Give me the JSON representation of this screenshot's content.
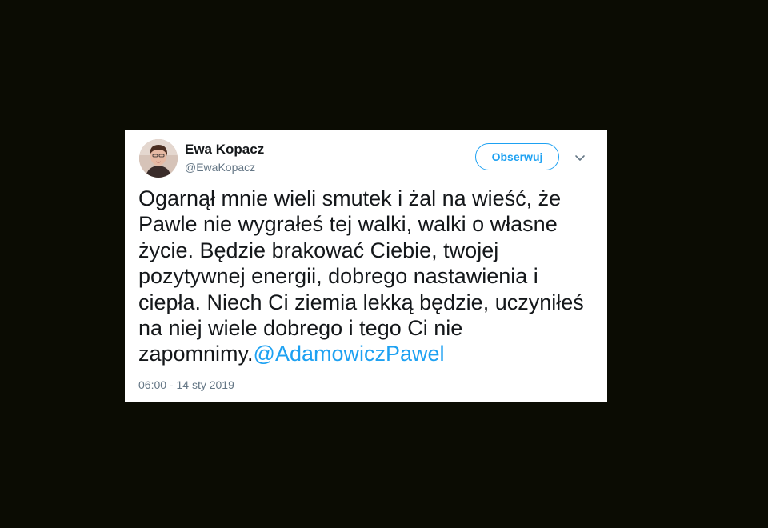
{
  "tweet": {
    "author_name": "Ewa Kopacz",
    "author_handle": "@EwaKopacz",
    "follow_label": "Obserwuj",
    "text": "Ogarnął mnie wieli smutek i żal na wieść, że Pawle nie wygrałeś tej walki, walki o własne życie. Będzie brakować Ciebie, twojej pozytywnej energii, dobrego nastawienia i ciepła. Niech Ci ziemia lekką będzie, uczyniłeś na niej wiele dobrego i tego Ci nie zapomnimy.",
    "mention": "@AdamowiczPawel",
    "timestamp": "06:00 - 14 sty 2019"
  },
  "icons": {
    "avatar": "profile-photo",
    "menu": "chevron-down-icon"
  },
  "colors": {
    "background": "#0b0c03",
    "card": "#ffffff",
    "accent": "#1da1f2",
    "text": "#14171a",
    "secondary": "#657786"
  }
}
